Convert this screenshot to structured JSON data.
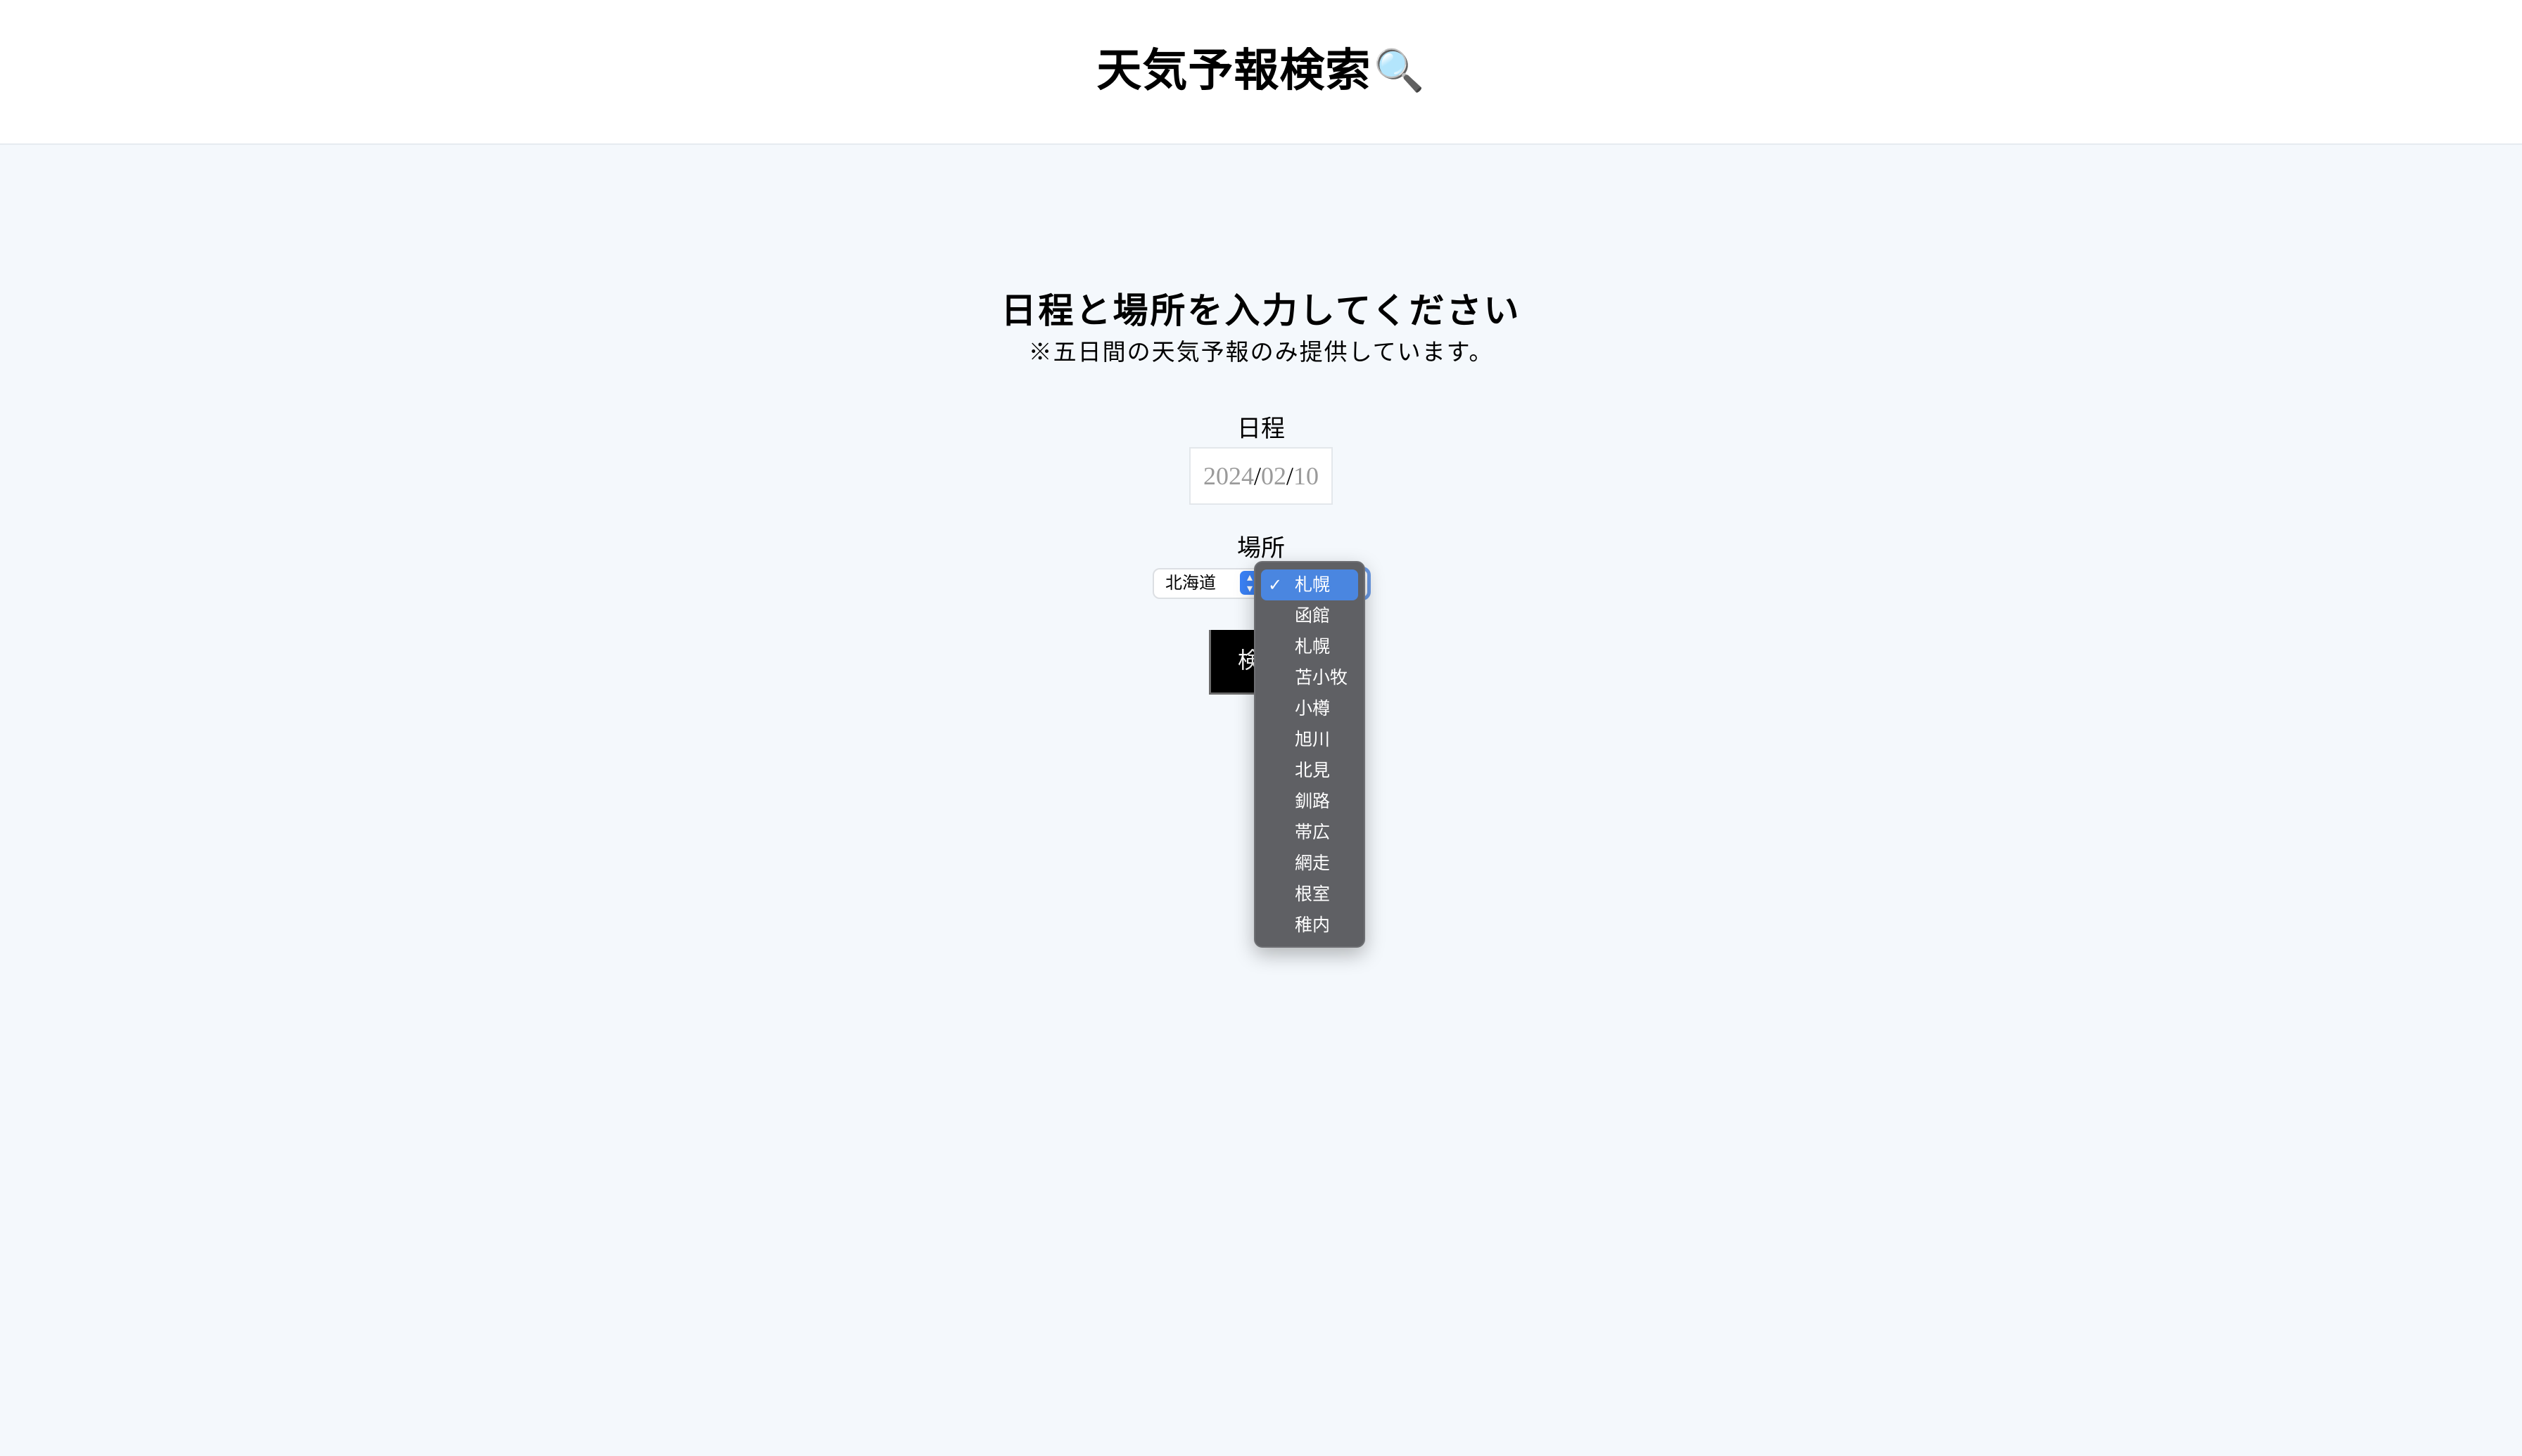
{
  "header": {
    "title": "天気予報検索",
    "title_icon": "🔍"
  },
  "main": {
    "heading": "日程と場所を入力してください",
    "note": "※五日間の天気予報のみ提供しています。"
  },
  "date": {
    "label": "日程",
    "year": "2024",
    "month": "02",
    "day": "10",
    "separator": "/"
  },
  "place": {
    "label": "場所",
    "prefecture_value": "北海道",
    "stepper_icon": "chevron-up-down-icon",
    "city_value": "札幌",
    "city_options": [
      "札幌",
      "函館",
      "札幌",
      "苫小牧",
      "小樽",
      "旭川",
      "北見",
      "釧路",
      "帯広",
      "網走",
      "根室",
      "稚内"
    ],
    "check_mark": "✓"
  },
  "search": {
    "label": "検索"
  },
  "colors": {
    "background": "#f4f8fc",
    "header": "#ffffff",
    "accent": "#4a86e0",
    "menu": "#5f6064",
    "button": "#000000"
  }
}
